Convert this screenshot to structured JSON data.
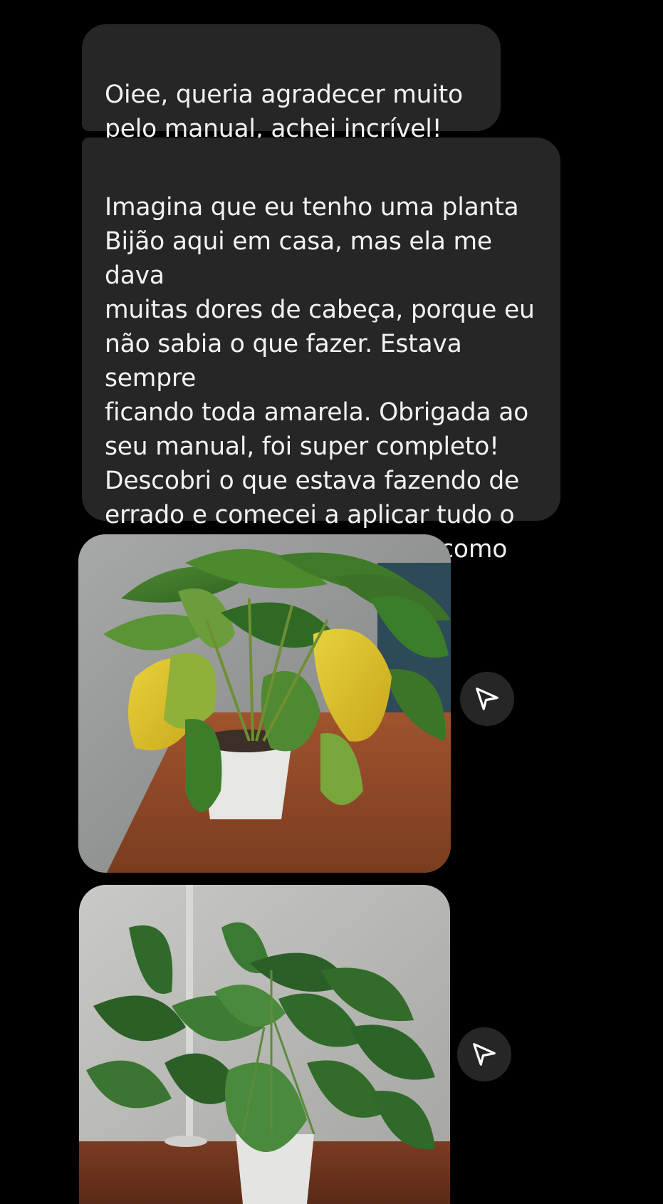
{
  "messages": [
    {
      "type": "text",
      "text": "Oiee, queria agradecer muito\npelo manual, achei incrível!"
    },
    {
      "type": "text",
      "text": "Imagina que eu tenho uma planta\nBijão aqui em casa, mas ela me dava\nmuitas dores de cabeça, porque eu\nnão sabia o que fazer. Estava sempre\nficando toda amarela. Obrigada ao\nseu manual, foi super completo!\nDescobri o que estava fazendo de\nerrado e comecei a aplicar tudo o\nque aprendi. Agora olha só como\nela está linda!"
    },
    {
      "type": "image",
      "subject": "plant-yellow-leaves-photo"
    },
    {
      "type": "image",
      "subject": "plant-healthy-green-photo"
    }
  ],
  "colors": {
    "background": "#000000",
    "bubble": "#262626",
    "text": "#f2f2f2",
    "share_button": "#262626"
  },
  "icons": {
    "share": "paper-plane-icon"
  }
}
